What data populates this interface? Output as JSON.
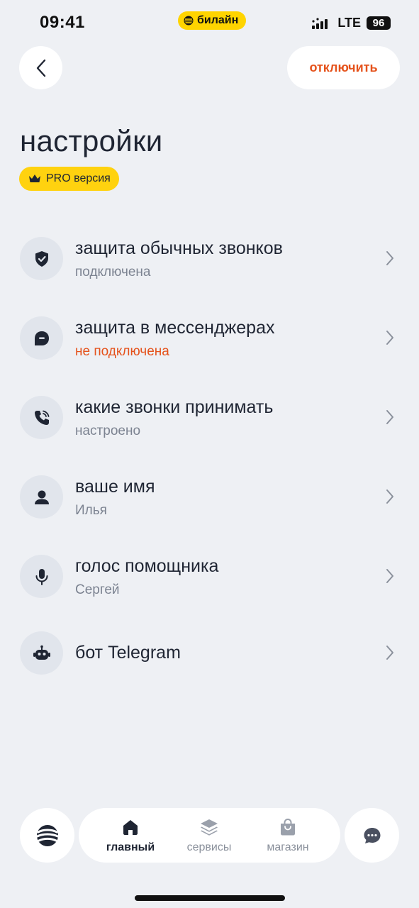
{
  "status_bar": {
    "time": "09:41",
    "carrier": "билайн",
    "network": "LTE",
    "battery": "96"
  },
  "header": {
    "disconnect_label": "отключить"
  },
  "page": {
    "title": "настройки",
    "badge": "PRO версия"
  },
  "settings": [
    {
      "title": "защита обычных звонков",
      "subtitle": "подключена",
      "icon": "shield-icon"
    },
    {
      "title": "защита в мессенджерах",
      "subtitle": "не подключена",
      "icon": "message-icon"
    },
    {
      "title": "какие звонки принимать",
      "subtitle": "настроено",
      "icon": "phone-icon"
    },
    {
      "title": "ваше имя",
      "subtitle": "Илья",
      "icon": "user-icon"
    },
    {
      "title": "голос помощника",
      "subtitle": "Сергей",
      "icon": "microphone-icon"
    },
    {
      "title": "бот Telegram",
      "icon": "robot-icon"
    }
  ],
  "bottom_nav": {
    "items": [
      {
        "label": "главный",
        "icon": "home-icon",
        "active": true
      },
      {
        "label": "сервисы",
        "icon": "layers-icon",
        "active": false
      },
      {
        "label": "магазин",
        "icon": "shopping-bag-icon",
        "active": false
      }
    ]
  },
  "colors": {
    "background": "#eef0f4",
    "accent_orange": "#e5521b",
    "brand_yellow": "#ffd400",
    "text_primary": "#1f2533",
    "text_secondary": "#7c8391"
  }
}
